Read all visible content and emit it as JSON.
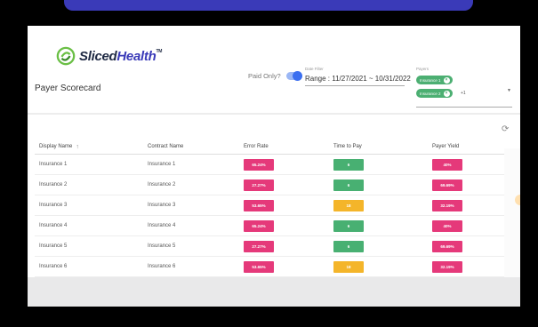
{
  "brand": {
    "name_part1": "Sliced",
    "name_part2": "Health",
    "tm": "TM"
  },
  "page_title": "Payer Scorecard",
  "paid_only": {
    "label": "Paid Only?",
    "on": true
  },
  "date_filter": {
    "label": "Date Filter",
    "value": "Range : 11/27/2021  ~  10/31/2022"
  },
  "payers": {
    "label": "Payers",
    "chips": [
      "Insurance 1",
      "Insurance 2"
    ],
    "more": "+1"
  },
  "table": {
    "columns": [
      "Display Name",
      "Contract Name",
      "Error Rate",
      "Time to Pay",
      "Payer Yield"
    ],
    "rows": [
      {
        "display": "Insurance 1",
        "contract": "Insurance 1",
        "error": "65.24%",
        "time": "6",
        "yield": "40%"
      },
      {
        "display": "Insurance 2",
        "contract": "Insurance 2",
        "error": "27.27%",
        "time": "6",
        "yield": "69.69%"
      },
      {
        "display": "Insurance 3",
        "contract": "Insurance 3",
        "error": "53.65%",
        "time": "18",
        "yield": "32.19%"
      },
      {
        "display": "Insurance 4",
        "contract": "Insurance 4",
        "error": "65.24%",
        "time": "6",
        "yield": "40%"
      },
      {
        "display": "Insurance 5",
        "contract": "Insurance 5",
        "error": "27.27%",
        "time": "6",
        "yield": "69.69%"
      },
      {
        "display": "Insurance 6",
        "contract": "Insurance 6",
        "error": "53.65%",
        "time": "18",
        "yield": "32.19%"
      }
    ]
  },
  "colors": {
    "error": "#e5397a",
    "time_fast": "#48b072",
    "time_slow": "#f4b52a",
    "yield": "#e5397a",
    "chip": "#4caf72",
    "toggle": "#3b6ff0"
  }
}
